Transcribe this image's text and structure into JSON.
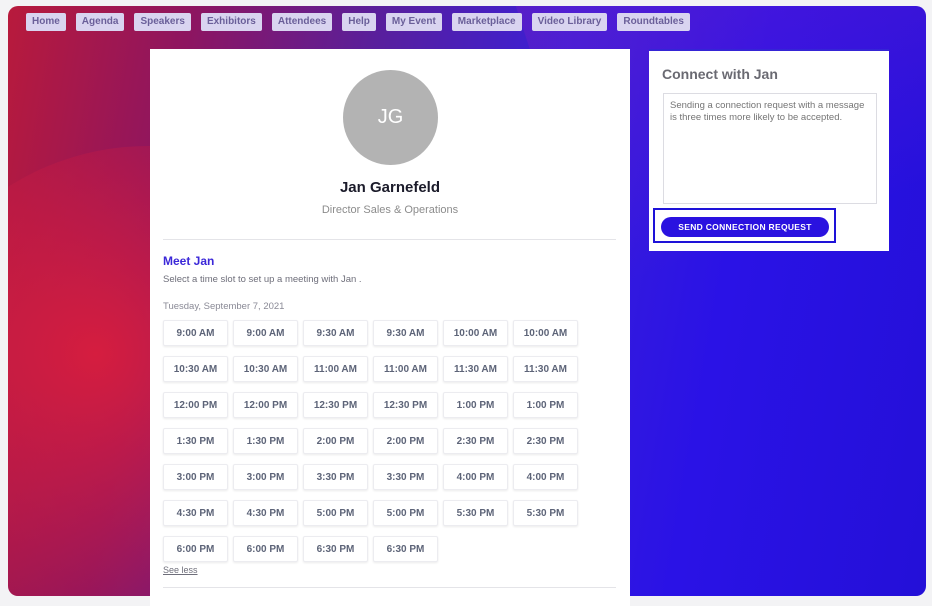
{
  "nav": {
    "items": [
      "Home",
      "Agenda",
      "Speakers",
      "Exhibitors",
      "Attendees",
      "Help",
      "My Event",
      "Marketplace",
      "Video Library",
      "Roundtables"
    ]
  },
  "profile": {
    "initials": "JG",
    "name": "Jan Garnefeld",
    "title": "Director Sales & Operations"
  },
  "meeting": {
    "heading": "Meet Jan",
    "subtitle": "Select a time slot to set up a meeting with Jan .",
    "date": "Tuesday, September 7, 2021",
    "slots": [
      "9:00 AM",
      "9:00 AM",
      "9:30 AM",
      "9:30 AM",
      "10:00 AM",
      "10:00 AM",
      "10:30 AM",
      "10:30 AM",
      "11:00 AM",
      "11:00 AM",
      "11:30 AM",
      "11:30 AM",
      "12:00 PM",
      "12:00 PM",
      "12:30 PM",
      "12:30 PM",
      "1:00 PM",
      "1:00 PM",
      "1:30 PM",
      "1:30 PM",
      "2:00 PM",
      "2:00 PM",
      "2:30 PM",
      "2:30 PM",
      "3:00 PM",
      "3:00 PM",
      "3:30 PM",
      "3:30 PM",
      "4:00 PM",
      "4:00 PM",
      "4:30 PM",
      "4:30 PM",
      "5:00 PM",
      "5:00 PM",
      "5:30 PM",
      "5:30 PM",
      "6:00 PM",
      "6:00 PM",
      "6:30 PM",
      "6:30 PM"
    ],
    "see_less": "See less"
  },
  "connect": {
    "title": "Connect with Jan",
    "message": "Sending a connection request with a message is three times more likely to be accepted.",
    "send_label": "SEND CONNECTION REQUEST"
  },
  "colors": {
    "accent": "#2a12e0",
    "nav_bg": "#d9d4f0",
    "nav_text": "#6a5f99"
  }
}
